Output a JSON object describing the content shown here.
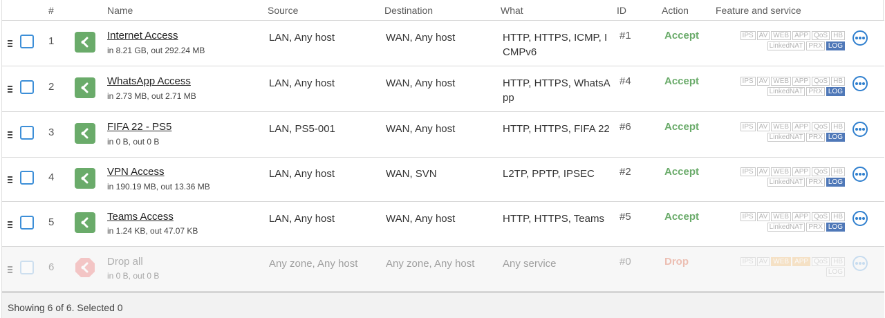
{
  "columns": {
    "num": "#",
    "name": "Name",
    "source": "Source",
    "destination": "Destination",
    "what": "What",
    "id": "ID",
    "action": "Action",
    "features": "Feature and service"
  },
  "rules": [
    {
      "num": "1",
      "name": "Internet Access",
      "traffic": "in 8.21 GB, out 292.24 MB",
      "source": "LAN, Any host",
      "destination": "WAN, Any host",
      "what": "HTTP, HTTPS, ICMP, ICMPv6",
      "id": "#1",
      "action": "Accept"
    },
    {
      "num": "2",
      "name": "WhatsApp Access",
      "traffic": "in 2.73 MB, out 2.71 MB",
      "source": "LAN, Any host",
      "destination": "WAN, Any host",
      "what": "HTTP, HTTPS, WhatsApp",
      "id": "#4",
      "action": "Accept"
    },
    {
      "num": "3",
      "name": "FIFA 22 - PS5",
      "traffic": "in 0 B, out 0 B",
      "source": "LAN, PS5-001",
      "destination": "WAN, Any host",
      "what": "HTTP, HTTPS, FIFA 22",
      "id": "#6",
      "action": "Accept"
    },
    {
      "num": "4",
      "name": "VPN Access",
      "traffic": "in 190.19 MB, out 13.36 MB",
      "source": "LAN, Any host",
      "destination": "WAN, SVN",
      "what": "L2TP, PPTP, IPSEC",
      "id": "#2",
      "action": "Accept"
    },
    {
      "num": "5",
      "name": "Teams Access",
      "traffic": "in 1.24 KB, out 47.07 KB",
      "source": "LAN, Any host",
      "destination": "WAN, Any host",
      "what": "HTTP, HTTPS, Teams",
      "id": "#5",
      "action": "Accept"
    },
    {
      "num": "6",
      "name": "Drop all",
      "traffic": "in 0 B, out 0 B",
      "source": "Any zone, Any host",
      "destination": "Any zone, Any host",
      "what": "Any service",
      "id": "#0",
      "action": "Drop"
    }
  ],
  "feature_tags": {
    "ips": "IPS",
    "av": "AV",
    "web": "WEB",
    "app": "APP",
    "qos": "QoS",
    "hb": "HB",
    "linkednat": "LinkedNAT",
    "prx": "PRX",
    "log": "LOG"
  },
  "colors": {
    "accept": "#6aab6a",
    "drop": "#e07a5f",
    "log_active": "#4f78b8",
    "link_blue": "#2f7fce"
  },
  "footer": {
    "status": "Showing 6 of 6. Selected 0"
  }
}
